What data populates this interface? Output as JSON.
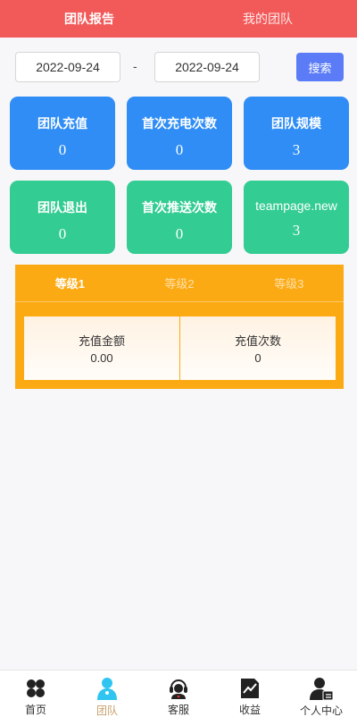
{
  "header": {
    "tabs": [
      {
        "label": "团队报告",
        "active": true
      },
      {
        "label": "我的团队",
        "active": false
      }
    ]
  },
  "filter": {
    "start_date": "2022-09-24",
    "separator": "-",
    "end_date": "2022-09-24",
    "search_label": "搜索"
  },
  "cards": [
    {
      "label": "团队充值",
      "value": "0",
      "color": "#2f8df5"
    },
    {
      "label": "首次充电次数",
      "value": "0",
      "color": "#2f8df5"
    },
    {
      "label": "团队规模",
      "value": "3",
      "color": "#2f8df5"
    },
    {
      "label": "团队退出",
      "value": "0",
      "color": "#33cc93"
    },
    {
      "label": "首次推送次数",
      "value": "0",
      "color": "#33cc93"
    },
    {
      "label": "teampage.new",
      "value": "3",
      "color": "#33cc93"
    }
  ],
  "levels": {
    "tabs": [
      {
        "label": "等级1",
        "active": true
      },
      {
        "label": "等级2",
        "active": false
      },
      {
        "label": "等级3",
        "active": false
      }
    ],
    "stats": [
      {
        "label": "充值金额",
        "value": "0.00"
      },
      {
        "label": "充值次数",
        "value": "0"
      }
    ],
    "accent": "#fbaa14"
  },
  "bottom_nav": [
    {
      "label": "首页",
      "icon": "home-grid-icon",
      "active": false
    },
    {
      "label": "团队",
      "icon": "team-icon",
      "active": true
    },
    {
      "label": "客服",
      "icon": "customer-service-icon",
      "active": false
    },
    {
      "label": "收益",
      "icon": "earnings-chart-icon",
      "active": false
    },
    {
      "label": "个人中心",
      "icon": "profile-icon",
      "active": false
    }
  ],
  "colors": {
    "header": "#f25a5a",
    "search_button": "#5b7cf6",
    "active_nav": "#c8a06a"
  }
}
